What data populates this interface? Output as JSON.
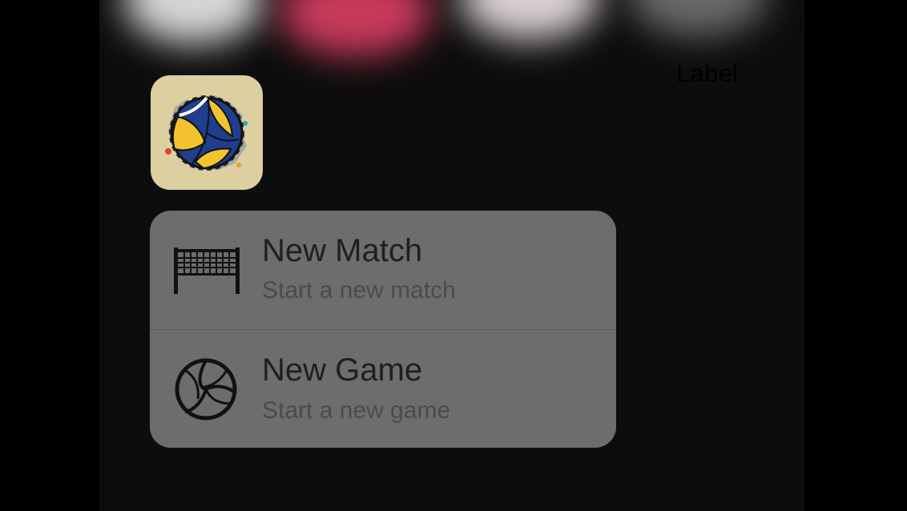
{
  "label": "Label",
  "app": {
    "icon": "volleyball-app-icon"
  },
  "shortcuts": [
    {
      "title": "New Match",
      "subtitle": "Start a new match",
      "icon": "volleyball-net-icon"
    },
    {
      "title": "New Game",
      "subtitle": "Start a new game",
      "icon": "volleyball-icon"
    }
  ],
  "colors": {
    "screen_background": "#0d0d0d",
    "menu_background": "#6d6d6d",
    "app_icon_background": "#dccfa0",
    "blurred_dot_red": "#c93a5c"
  }
}
